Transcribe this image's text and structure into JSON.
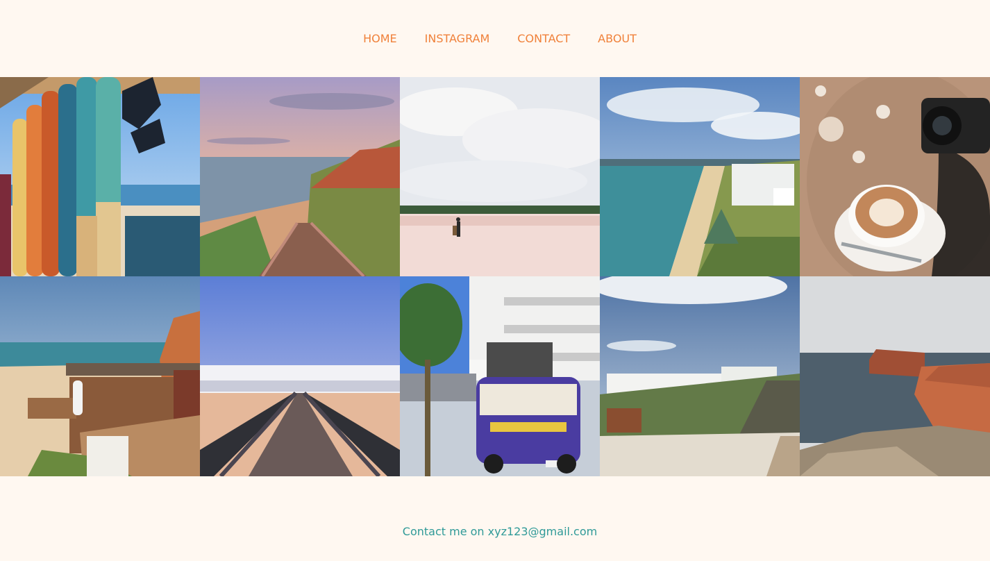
{
  "nav": {
    "items": [
      "HOME",
      "INSTAGRAM",
      "CONTACT",
      "ABOUT"
    ],
    "color": "#f0813a"
  },
  "footer": {
    "text": "Contact me on xyz123@gmail.com",
    "color": "#2f9a98"
  },
  "colors": {
    "background": "#fff8f1"
  }
}
